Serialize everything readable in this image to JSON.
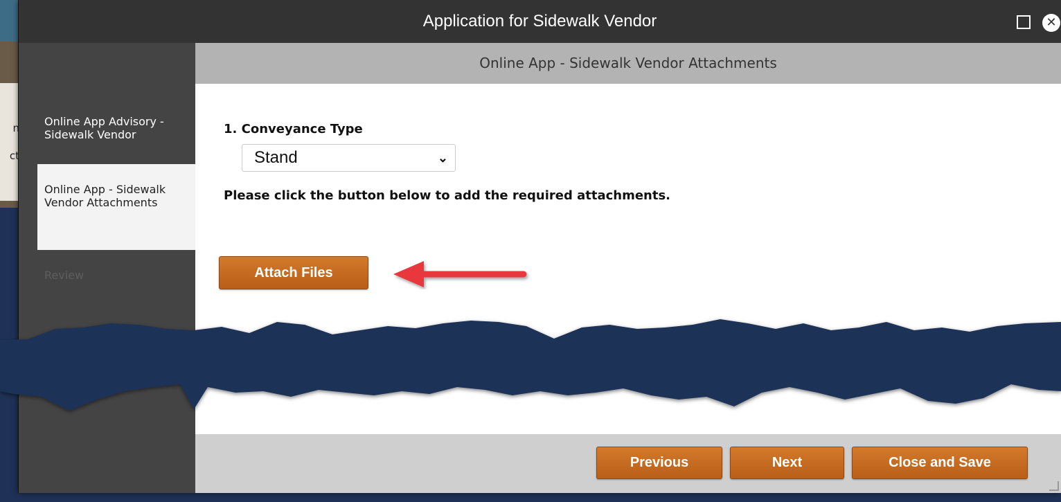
{
  "window": {
    "title": "Application for Sidewalk Vendor"
  },
  "background": {
    "fragment_1": "n",
    "fragment_2": "ct"
  },
  "sidebar": {
    "items": [
      {
        "label": "Online App Advisory - Sidewalk Vendor",
        "state": "done"
      },
      {
        "label": "Online App - Sidewalk Vendor Attachments",
        "state": "active"
      },
      {
        "label": "Review",
        "state": "disabled"
      }
    ]
  },
  "main": {
    "section_title": "Online App - Sidewalk Vendor Attachments",
    "question_label": "1. Conveyance Type",
    "conveyance_select": {
      "value": "Stand"
    },
    "instructions": "Please click the button below to add the required attachments.",
    "attach_button": "Attach Files"
  },
  "footer": {
    "previous": "Previous",
    "next": "Next",
    "close_save": "Close and Save"
  },
  "colors": {
    "accent_button": "#c46a22",
    "arrow": "#e8393c",
    "torn_band": "#1f3156"
  },
  "icons": [
    "maximize-icon",
    "close-icon",
    "chevron-down-icon",
    "red-arrow-annotation"
  ]
}
